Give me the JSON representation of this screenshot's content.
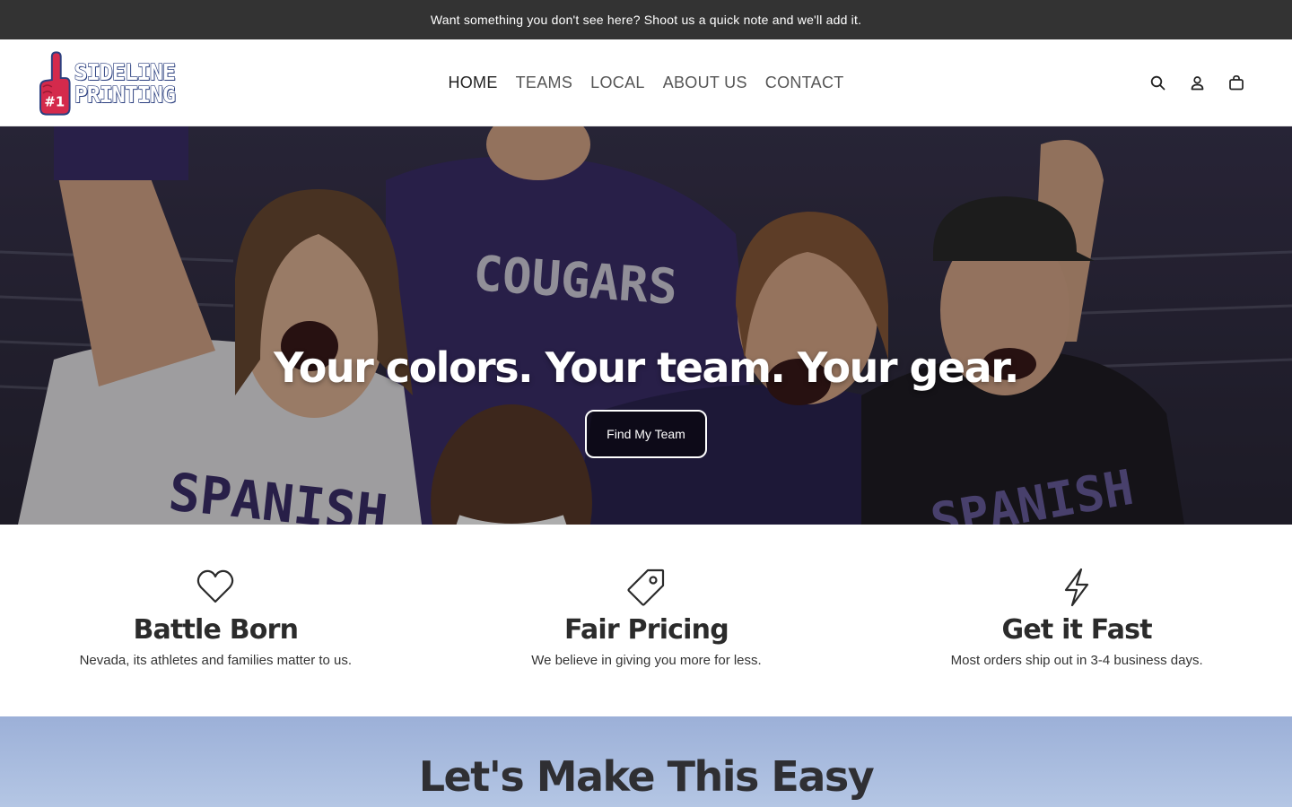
{
  "announcement": {
    "text": "Want something you don't see here? Shoot us a quick note and we'll add it."
  },
  "header": {
    "logo": {
      "line1": "SIDELINE",
      "line2": "PRINTING",
      "badge": "#1"
    },
    "nav": [
      {
        "label": "HOME",
        "active": true
      },
      {
        "label": "TEAMS",
        "active": false
      },
      {
        "label": "LOCAL",
        "active": false
      },
      {
        "label": "ABOUT US",
        "active": false
      },
      {
        "label": "CONTACT",
        "active": false
      }
    ],
    "icons": [
      "search-icon",
      "account-icon",
      "cart-icon"
    ]
  },
  "hero": {
    "title": "Your colors. Your team. Your gear.",
    "button_label": "Find My Team",
    "shirt_text_1": "COUGARS",
    "shirt_text_2": "SPANISH",
    "shirt_text_3": "SPANISH"
  },
  "features": [
    {
      "icon": "heart-icon",
      "title": "Battle Born",
      "description": "Nevada, its athletes and families matter to us."
    },
    {
      "icon": "price-tag-icon",
      "title": "Fair Pricing",
      "description": "We believe in giving you more for less."
    },
    {
      "icon": "lightning-icon",
      "title": "Get it Fast",
      "description": "Most orders ship out in 3-4 business days."
    }
  ],
  "easy_section": {
    "title": "Let's Make This Easy"
  },
  "colors": {
    "announcement_bg": "#333333",
    "brand_red": "#d42a4c",
    "brand_navy": "#2b3f7f",
    "team_purple": "#3b2f6b",
    "easy_bg": "#a9bde0"
  }
}
